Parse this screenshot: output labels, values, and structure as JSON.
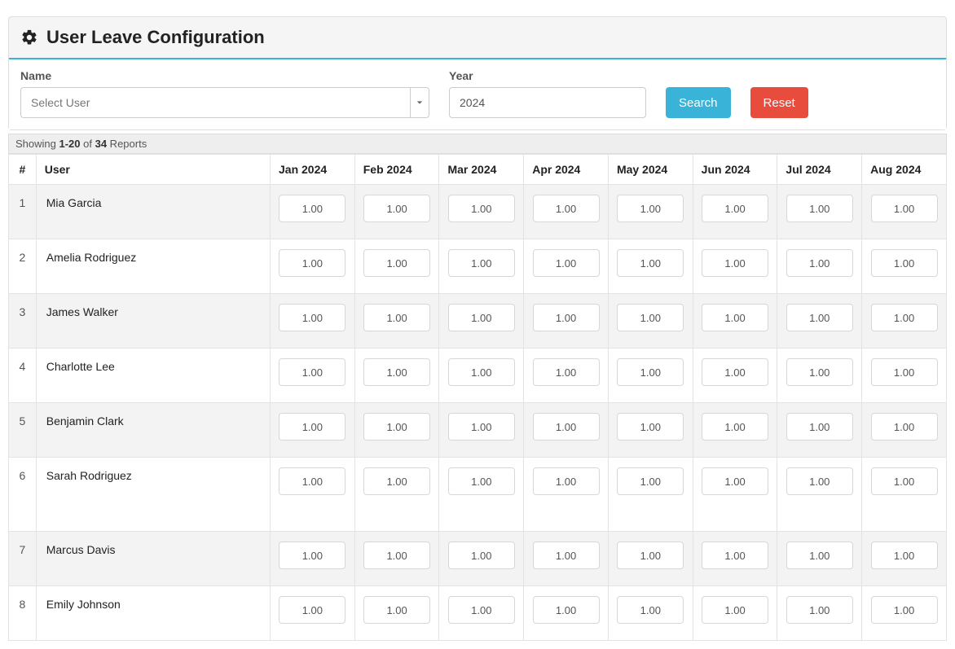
{
  "header": {
    "title": "User Leave Configuration"
  },
  "filters": {
    "name_label": "Name",
    "name_placeholder": "Select User",
    "year_label": "Year",
    "year_value": "2024",
    "search_label": "Search",
    "reset_label": "Reset"
  },
  "summary": {
    "prefix": "Showing ",
    "range": "1-20",
    "of": " of ",
    "total": "34",
    "suffix": " Reports"
  },
  "table": {
    "columns": {
      "idx": "#",
      "user": "User",
      "months": [
        "Jan 2024",
        "Feb 2024",
        "Mar 2024",
        "Apr 2024",
        "May 2024",
        "Jun 2024",
        "Jul 2024",
        "Aug 2024"
      ]
    },
    "rows": [
      {
        "idx": "1",
        "user": "Mia Garcia",
        "values": [
          "1.00",
          "1.00",
          "1.00",
          "1.00",
          "1.00",
          "1.00",
          "1.00",
          "1.00"
        ],
        "tall": false
      },
      {
        "idx": "2",
        "user": "Amelia Rodriguez",
        "values": [
          "1.00",
          "1.00",
          "1.00",
          "1.00",
          "1.00",
          "1.00",
          "1.00",
          "1.00"
        ],
        "tall": false
      },
      {
        "idx": "3",
        "user": "James Walker",
        "values": [
          "1.00",
          "1.00",
          "1.00",
          "1.00",
          "1.00",
          "1.00",
          "1.00",
          "1.00"
        ],
        "tall": false
      },
      {
        "idx": "4",
        "user": "Charlotte Lee",
        "values": [
          "1.00",
          "1.00",
          "1.00",
          "1.00",
          "1.00",
          "1.00",
          "1.00",
          "1.00"
        ],
        "tall": false
      },
      {
        "idx": "5",
        "user": "Benjamin Clark",
        "values": [
          "1.00",
          "1.00",
          "1.00",
          "1.00",
          "1.00",
          "1.00",
          "1.00",
          "1.00"
        ],
        "tall": false
      },
      {
        "idx": "6",
        "user": "Sarah Rodriguez",
        "values": [
          "1.00",
          "1.00",
          "1.00",
          "1.00",
          "1.00",
          "1.00",
          "1.00",
          "1.00"
        ],
        "tall": true
      },
      {
        "idx": "7",
        "user": "Marcus Davis",
        "values": [
          "1.00",
          "1.00",
          "1.00",
          "1.00",
          "1.00",
          "1.00",
          "1.00",
          "1.00"
        ],
        "tall": false
      },
      {
        "idx": "8",
        "user": "Emily Johnson",
        "values": [
          "1.00",
          "1.00",
          "1.00",
          "1.00",
          "1.00",
          "1.00",
          "1.00",
          "1.00"
        ],
        "tall": false
      }
    ]
  }
}
